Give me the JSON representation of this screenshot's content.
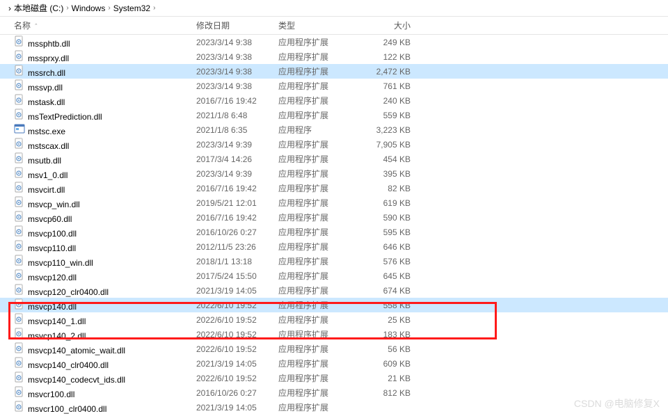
{
  "breadcrumb": {
    "items": [
      "本地磁盘 (C:)",
      "Windows",
      "System32"
    ],
    "separator": "›"
  },
  "columns": {
    "name": "名称",
    "date": "修改日期",
    "type": "类型",
    "size": "大小"
  },
  "type_labels": {
    "ext": "应用程序扩展",
    "app": "应用程序"
  },
  "files": [
    {
      "name": "mssphtb.dll",
      "date": "2023/3/14 9:38",
      "type": "ext",
      "size": "249 KB",
      "icon": "dll",
      "selected": false
    },
    {
      "name": "mssprxy.dll",
      "date": "2023/3/14 9:38",
      "type": "ext",
      "size": "122 KB",
      "icon": "dll",
      "selected": false
    },
    {
      "name": "mssrch.dll",
      "date": "2023/3/14 9:38",
      "type": "ext",
      "size": "2,472 KB",
      "icon": "dll",
      "selected": true
    },
    {
      "name": "mssvp.dll",
      "date": "2023/3/14 9:38",
      "type": "ext",
      "size": "761 KB",
      "icon": "dll",
      "selected": false
    },
    {
      "name": "mstask.dll",
      "date": "2016/7/16 19:42",
      "type": "ext",
      "size": "240 KB",
      "icon": "dll",
      "selected": false
    },
    {
      "name": "msTextPrediction.dll",
      "date": "2021/1/8 6:48",
      "type": "ext",
      "size": "559 KB",
      "icon": "dll",
      "selected": false
    },
    {
      "name": "mstsc.exe",
      "date": "2021/1/8 6:35",
      "type": "app",
      "size": "3,223 KB",
      "icon": "exe",
      "selected": false
    },
    {
      "name": "mstscax.dll",
      "date": "2023/3/14 9:39",
      "type": "ext",
      "size": "7,905 KB",
      "icon": "dll",
      "selected": false
    },
    {
      "name": "msutb.dll",
      "date": "2017/3/4 14:26",
      "type": "ext",
      "size": "454 KB",
      "icon": "dll",
      "selected": false
    },
    {
      "name": "msv1_0.dll",
      "date": "2023/3/14 9:39",
      "type": "ext",
      "size": "395 KB",
      "icon": "dll",
      "selected": false
    },
    {
      "name": "msvcirt.dll",
      "date": "2016/7/16 19:42",
      "type": "ext",
      "size": "82 KB",
      "icon": "dll",
      "selected": false
    },
    {
      "name": "msvcp_win.dll",
      "date": "2019/5/21 12:01",
      "type": "ext",
      "size": "619 KB",
      "icon": "dll",
      "selected": false
    },
    {
      "name": "msvcp60.dll",
      "date": "2016/7/16 19:42",
      "type": "ext",
      "size": "590 KB",
      "icon": "dll",
      "selected": false
    },
    {
      "name": "msvcp100.dll",
      "date": "2016/10/26 0:27",
      "type": "ext",
      "size": "595 KB",
      "icon": "dll",
      "selected": false
    },
    {
      "name": "msvcp110.dll",
      "date": "2012/11/5 23:26",
      "type": "ext",
      "size": "646 KB",
      "icon": "dll",
      "selected": false
    },
    {
      "name": "msvcp110_win.dll",
      "date": "2018/1/1 13:18",
      "type": "ext",
      "size": "576 KB",
      "icon": "dll",
      "selected": false
    },
    {
      "name": "msvcp120.dll",
      "date": "2017/5/24 15:50",
      "type": "ext",
      "size": "645 KB",
      "icon": "dll",
      "selected": false
    },
    {
      "name": "msvcp120_clr0400.dll",
      "date": "2021/3/19 14:05",
      "type": "ext",
      "size": "674 KB",
      "icon": "dll",
      "selected": false
    },
    {
      "name": "msvcp140.dll",
      "date": "2022/6/10 19:52",
      "type": "ext",
      "size": "558 KB",
      "icon": "dll",
      "selected": true
    },
    {
      "name": "msvcp140_1.dll",
      "date": "2022/6/10 19:52",
      "type": "ext",
      "size": "25 KB",
      "icon": "dll",
      "selected": false
    },
    {
      "name": "msvcp140_2.dll",
      "date": "2022/6/10 19:52",
      "type": "ext",
      "size": "183 KB",
      "icon": "dll",
      "selected": false
    },
    {
      "name": "msvcp140_atomic_wait.dll",
      "date": "2022/6/10 19:52",
      "type": "ext",
      "size": "56 KB",
      "icon": "dll",
      "selected": false
    },
    {
      "name": "msvcp140_clr0400.dll",
      "date": "2021/3/19 14:05",
      "type": "ext",
      "size": "609 KB",
      "icon": "dll",
      "selected": false
    },
    {
      "name": "msvcp140_codecvt_ids.dll",
      "date": "2022/6/10 19:52",
      "type": "ext",
      "size": "21 KB",
      "icon": "dll",
      "selected": false
    },
    {
      "name": "msvcr100.dll",
      "date": "2016/10/26 0:27",
      "type": "ext",
      "size": "812 KB",
      "icon": "dll",
      "selected": false
    },
    {
      "name": "msvcr100_clr0400.dll",
      "date": "2021/3/19 14:05",
      "type": "ext",
      "size": "",
      "icon": "dll",
      "selected": false
    }
  ],
  "watermark": "CSDN @电脑修复X"
}
